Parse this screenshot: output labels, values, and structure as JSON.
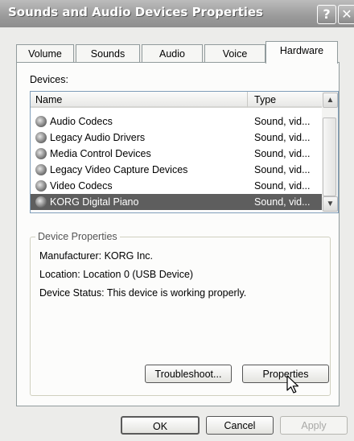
{
  "window": {
    "title": "Sounds and Audio Devices Properties",
    "help_label": "?",
    "close_label": "✕"
  },
  "tabs": [
    {
      "label": "Volume"
    },
    {
      "label": "Sounds"
    },
    {
      "label": "Audio"
    },
    {
      "label": "Voice"
    },
    {
      "label": "Hardware",
      "active": true
    }
  ],
  "devices": {
    "label": "Devices:",
    "columns": {
      "name": "Name",
      "type": "Type"
    },
    "rows": [
      {
        "name": "Audio Codecs",
        "type": "Sound, vid..."
      },
      {
        "name": "Legacy Audio Drivers",
        "type": "Sound, vid..."
      },
      {
        "name": "Media Control Devices",
        "type": "Sound, vid..."
      },
      {
        "name": "Legacy Video Capture Devices",
        "type": "Sound, vid..."
      },
      {
        "name": "Video Codecs",
        "type": "Sound, vid..."
      },
      {
        "name": "KORG Digital Piano",
        "type": "Sound, vid...",
        "selected": true
      }
    ]
  },
  "device_properties": {
    "legend": "Device Properties",
    "manufacturer": "Manufacturer: KORG Inc.",
    "location": "Location: Location 0 (USB Device)",
    "status": "Device Status: This device is working properly.",
    "troubleshoot_label": "Troubleshoot...",
    "properties_label": "Properties"
  },
  "footer": {
    "ok_label": "OK",
    "cancel_label": "Cancel",
    "apply_label": "Apply"
  }
}
